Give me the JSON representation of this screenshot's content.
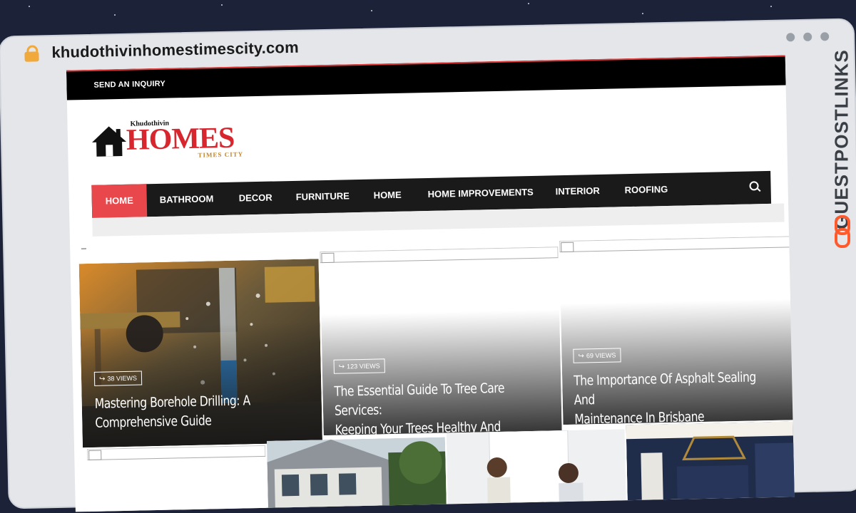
{
  "browser": {
    "url": "khudothivinhomestimescity.com"
  },
  "site": {
    "topbar_link": "SEND AN INQUIRY",
    "logo": {
      "small": "Khudothivin",
      "big": "HOMES",
      "tagline": "TIMES CITY"
    },
    "nav": [
      {
        "label": "HOME",
        "active": true
      },
      {
        "label": "BATHROOM",
        "active": false
      },
      {
        "label": "DECOR",
        "active": false
      },
      {
        "label": "FURNITURE",
        "active": false
      },
      {
        "label": "HOME",
        "active": false
      },
      {
        "label": "HOME IMPROVEMENTS",
        "active": false
      },
      {
        "label": "INTERIOR",
        "active": false
      },
      {
        "label": "ROOFING",
        "active": false
      }
    ],
    "dash": "_"
  },
  "featured": [
    {
      "views": "38 VIEWS",
      "title_line1": "Mastering Borehole Drilling: A",
      "title_line2": "Comprehensive Guide"
    },
    {
      "views": "123 VIEWS",
      "title_line1": "The Essential Guide To Tree Care Services:",
      "title_line2": "Keeping Your Trees Healthy And Beautiful"
    },
    {
      "views": "69 VIEWS",
      "title_line1": "The Importance Of Asphalt Sealing And",
      "title_line2": "Maintenance In Brisbane"
    }
  ],
  "badge": {
    "text": "GUESTPOSTLINKS"
  },
  "colors": {
    "accent": "#e8474c",
    "brand_red": "#d8262f",
    "badge_orange": "#ff5a2c"
  }
}
